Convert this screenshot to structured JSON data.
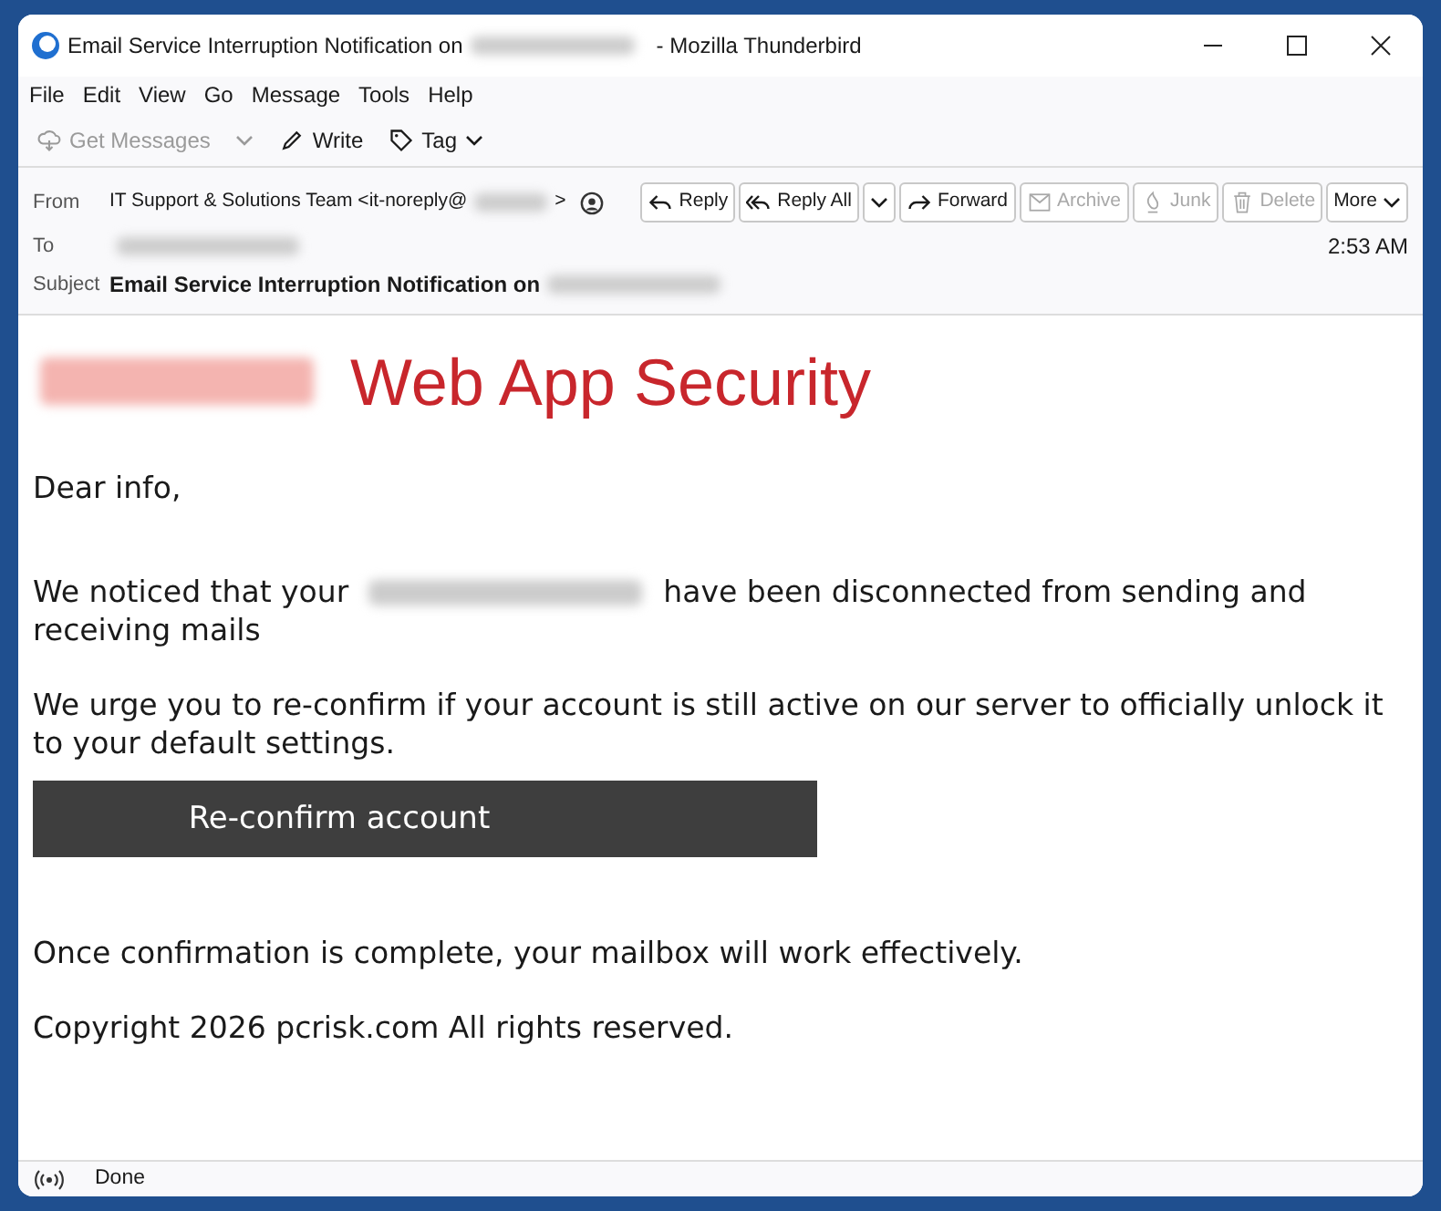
{
  "window": {
    "title": "Email Service Interruption Notification on",
    "title_redacted": true,
    "app": "- Mozilla Thunderbird"
  },
  "menu": [
    "File",
    "Edit",
    "View",
    "Go",
    "Message",
    "Tools",
    "Help"
  ],
  "toolbar": [
    {
      "kind": "get",
      "label": "Get Messages",
      "disabled": true
    },
    {
      "kind": "write",
      "label": "Write",
      "disabled": false
    },
    {
      "kind": "tag",
      "label": "Tag",
      "disabled": false
    }
  ],
  "header": {
    "from_label": "From",
    "from": "IT Support & Solutions Team <it-noreply@",
    "from_end": ">",
    "to_label": "To",
    "to_redacted": true,
    "time": "2:53 AM",
    "subject_label": "Subject",
    "subject": "Email Service Interruption Notification on",
    "subject_redacted": true
  },
  "actions": [
    {
      "kind": "reply",
      "label": "Reply",
      "disabled": false
    },
    {
      "kind": "replyall",
      "label": "Reply All",
      "disabled": false
    },
    {
      "kind": "forward",
      "label": "Forward",
      "disabled": false
    },
    {
      "kind": "archive",
      "label": "Archive",
      "disabled": true
    },
    {
      "kind": "junk",
      "label": "Junk",
      "disabled": true
    },
    {
      "kind": "delete",
      "label": "Delete",
      "disabled": true
    },
    {
      "kind": "more",
      "label": "More",
      "disabled": false
    }
  ],
  "message": {
    "logo_redacted": true,
    "brand": "Web App Security",
    "greeting": "Dear info,",
    "para1_start": "We noticed that your",
    "para1_redacted": true,
    "para1_end": "have been disconnected from sending and receiving mails",
    "para2": "We urge you to re-confirm if your account is still active on our server to officially unlock it to your default settings.",
    "button": "Re-confirm account",
    "para3": "Once confirmation is complete, your mailbox will work effectively.",
    "footer": "Copyright 2026 pcrisk.com All rights reserved."
  },
  "status_bar": {
    "text": "Done"
  }
}
